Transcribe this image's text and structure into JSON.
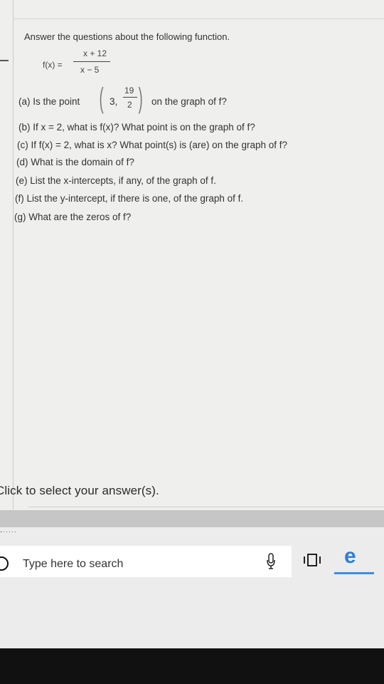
{
  "problem": {
    "intro": "Answer the questions about the following function.",
    "function_label": "f(x) =",
    "numerator": "x + 12",
    "denominator": "x − 5",
    "questions": {
      "a_prefix": "(a)  Is the point",
      "a_point_x": "3,",
      "a_point_y_num": "19",
      "a_point_y_den": "2",
      "a_suffix": "on the graph of f?",
      "b": "(b)  If x = 2, what is f(x)? What point is on the graph of f?",
      "c": "(c)  If f(x) = 2, what is x? What point(s) is (are) on the graph of f?",
      "d": "(d)  What is the domain of f?",
      "e": "(e)  List the x-intercepts, if any, of the graph of f.",
      "f": "(f)  List the y-intercept, if there is one, of the graph of f.",
      "g": "(g)  What are the zeros of f?"
    },
    "click_prompt": "Click to select your answer(s)."
  },
  "taskbar": {
    "search_placeholder": "Type here to search",
    "icons": [
      "search-circle-icon",
      "microphone-icon",
      "task-view-icon",
      "edge-browser-icon"
    ],
    "accent_color": "#2f7fd4"
  }
}
